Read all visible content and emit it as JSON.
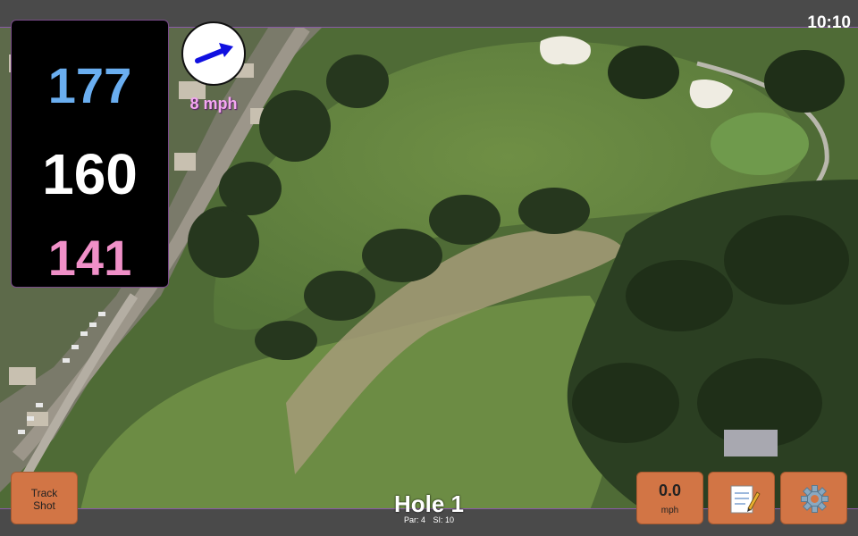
{
  "status": {
    "clock": "10:10"
  },
  "distances": {
    "back": "177",
    "center": "160",
    "front": "141"
  },
  "wind": {
    "speed": "8 mph",
    "direction_icon": "arrow-east-northeast-icon"
  },
  "hole": {
    "title": "Hole 1",
    "par": "Par: 4",
    "stroke_index": "SI: 10"
  },
  "buttons": {
    "track_shot": {
      "line1": "Track",
      "line2": "Shot"
    },
    "speed": {
      "value": "0.0",
      "unit": "mph"
    },
    "notes_icon": "notepad-icon",
    "settings_icon": "gear-icon"
  },
  "colors": {
    "back_distance": "#6aaef0",
    "center_distance": "#ffffff",
    "front_distance": "#f090c8",
    "wind_text": "#f3a8f0",
    "button_orange": "#d27545"
  }
}
